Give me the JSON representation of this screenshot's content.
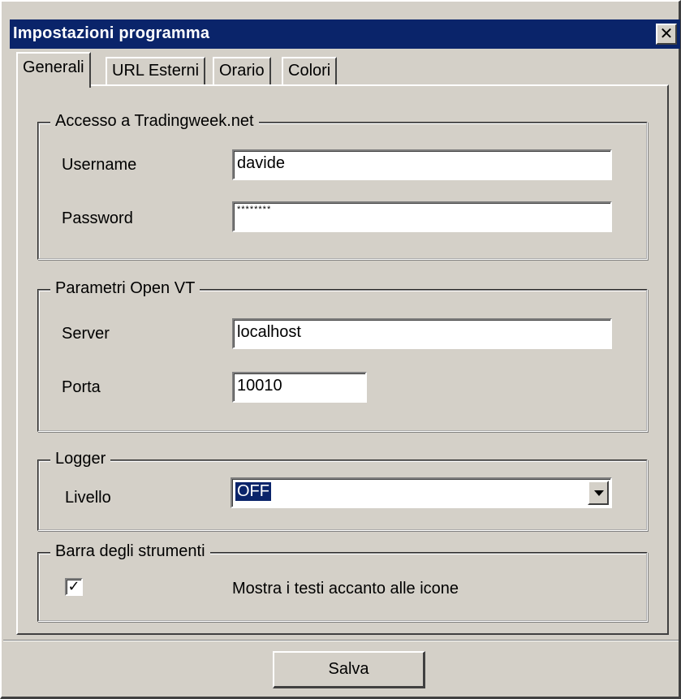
{
  "window": {
    "title": "Impostazioni programma",
    "close_glyph": "✕"
  },
  "tabs": [
    {
      "label": "Generali",
      "active": true
    },
    {
      "label": "URL Esterni",
      "active": false
    },
    {
      "label": "Orario",
      "active": false
    },
    {
      "label": "Colori",
      "active": false
    }
  ],
  "access": {
    "legend": "Accesso a Tradingweek.net",
    "username_label": "Username",
    "username_value": "davide",
    "password_label": "Password",
    "password_value": "********"
  },
  "openvt": {
    "legend": "Parametri Open VT",
    "server_label": "Server",
    "server_value": "localhost",
    "port_label": "Porta",
    "port_value": "10010"
  },
  "logger": {
    "legend": "Logger",
    "level_label": "Livello",
    "level_value": "OFF"
  },
  "toolbar": {
    "legend": "Barra degli strumenti",
    "show_text_checked": true,
    "check_glyph": "✓",
    "show_text_label": "Mostra i testi accanto alle icone"
  },
  "footer": {
    "save_label": "Salva"
  },
  "colors": {
    "titlebar": "#0a246a",
    "face": "#d4d0c8",
    "selection": "#0a246a"
  }
}
